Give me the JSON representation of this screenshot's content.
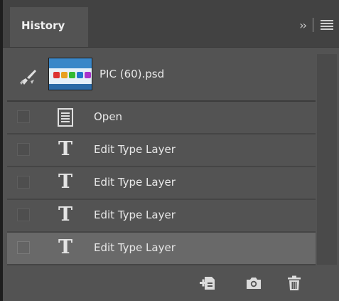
{
  "panel": {
    "tab_label": "History",
    "collapse_icon": "double-chevron-right-icon",
    "menu_icon": "hamburger-menu-icon"
  },
  "snapshot": {
    "name": "PIC (60).psd",
    "source_icon": "history-brush-icon"
  },
  "history_items": [
    {
      "label": "Open",
      "icon": "document-icon",
      "selected": false
    },
    {
      "label": "Edit Type Layer",
      "icon": "type-tool-icon",
      "selected": false
    },
    {
      "label": "Edit Type Layer",
      "icon": "type-tool-icon",
      "selected": false
    },
    {
      "label": "Edit Type Layer",
      "icon": "type-tool-icon",
      "selected": false
    },
    {
      "label": "Edit Type Layer",
      "icon": "type-tool-icon",
      "selected": true
    }
  ],
  "footer": {
    "buttons": [
      "new-document-from-state-icon",
      "camera-icon",
      "trash-icon"
    ]
  },
  "colors": {
    "panel_bg": "#535353",
    "tabbar_bg": "#424242",
    "selected_row": "#696969",
    "text": "#e8e8e8"
  }
}
